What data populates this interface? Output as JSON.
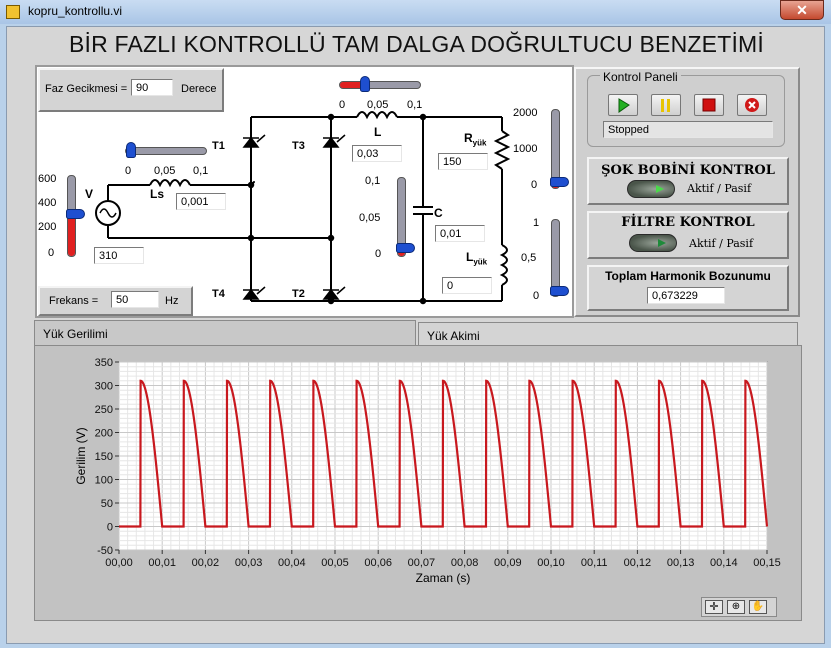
{
  "window": {
    "title": "kopru_kontrollu.vi",
    "close_glyph": "✕"
  },
  "header": {
    "title": "BİR FAZLI KONTROLLÜ TAM DALGA DOĞRULTUCU BENZETİMİ"
  },
  "circuit": {
    "phase_delay_label": "Faz Gecikmesi =",
    "phase_delay_value": "90",
    "phase_delay_unit": "Derece",
    "frequency_label": "Frekans =",
    "frequency_value": "50",
    "frequency_unit": "Hz",
    "source_label": "V",
    "source_slider_ticks": [
      "600",
      "400",
      "200",
      "0"
    ],
    "source_slider_level": 0.517,
    "source_value": "310",
    "ls_label": "Ls",
    "ls_slider_ticks": [
      "0",
      "0,05",
      "0,1"
    ],
    "ls_slider_level": 0.01,
    "ls_value": "0,001",
    "t1": "T1",
    "t2": "T2",
    "t3": "T3",
    "t4": "T4",
    "l_label": "L",
    "l_slider_ticks": [
      "0",
      "0,05",
      "0,1"
    ],
    "l_slider_level": 0.3,
    "l_value": "0,03",
    "c_label": "C",
    "c_slider_ticks": [
      "0,1",
      "0,05",
      "0"
    ],
    "c_slider_level": 0.1,
    "c_value": "0,01",
    "r_label": "R",
    "r_sub": "yük",
    "r_slider_ticks": [
      "2000",
      "1000",
      "0"
    ],
    "r_slider_level": 0.075,
    "r_value": "150",
    "lload_label": "L",
    "lload_sub": "yük",
    "lload_slider_ticks": [
      "1",
      "0,5",
      "0"
    ],
    "lload_slider_level": 0.0,
    "lload_value": "0"
  },
  "control_panel": {
    "title": "Kontrol Paneli",
    "buttons": [
      "run-icon",
      "pause-icon",
      "stop-icon",
      "close-circle-icon"
    ],
    "status": "Stopped",
    "choke_title": "ŞOK BOBİNİ KONTROL",
    "choke_toggle_label": "Aktif / Pasif",
    "filter_title": "FİLTRE KONTROL",
    "filter_toggle_label": "Aktif / Pasif",
    "thd_title": "Toplam Harmonik Bozunumu",
    "thd_value": "0,673229"
  },
  "tabs": [
    {
      "label": "Yük Gerilimi",
      "active": true
    },
    {
      "label": "Yük Akimi",
      "active": false
    }
  ],
  "graph_tools": [
    "cursor-icon",
    "zoom-icon",
    "pan-hand-icon"
  ],
  "colors": {
    "trace": "#c8181e",
    "slider_fill": "#e02020",
    "slider_knob": "#1e4fd0"
  },
  "chart_data": {
    "type": "line",
    "title": "",
    "xlabel": "Zaman (s)",
    "ylabel": "Gerilim (V)",
    "xlim": [
      0,
      0.15
    ],
    "ylim": [
      -50,
      350
    ],
    "x_ticks": [
      "00,00",
      "00,01",
      "00,02",
      "00,03",
      "00,04",
      "00,05",
      "00,06",
      "00,07",
      "00,08",
      "00,09",
      "00,10",
      "00,11",
      "00,12",
      "00,13",
      "00,14",
      "00,15"
    ],
    "y_ticks": [
      "350",
      "300",
      "250",
      "200",
      "150",
      "100",
      "50",
      "0",
      "-50"
    ],
    "grid": true,
    "series": [
      {
        "peak": 310,
        "frequency_hz": 50,
        "firing_angle_deg": 90,
        "x": [
          0,
          0.005,
          0.0075,
          0.01,
          0.015,
          0.0175,
          0.02,
          0.15
        ],
        "y": [
          0,
          310,
          219,
          0,
          310,
          219,
          0,
          0
        ]
      }
    ]
  }
}
